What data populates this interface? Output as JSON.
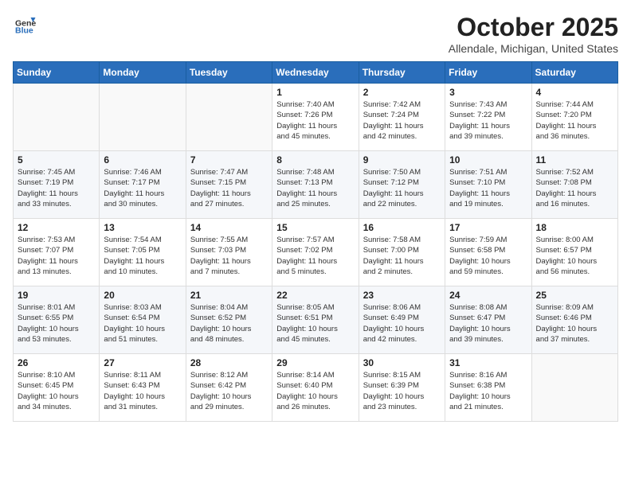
{
  "header": {
    "logo": {
      "line1": "General",
      "line2": "Blue"
    },
    "title": "October 2025",
    "location": "Allendale, Michigan, United States"
  },
  "weekdays": [
    "Sunday",
    "Monday",
    "Tuesday",
    "Wednesday",
    "Thursday",
    "Friday",
    "Saturday"
  ],
  "weeks": [
    [
      {
        "day": "",
        "detail": ""
      },
      {
        "day": "",
        "detail": ""
      },
      {
        "day": "",
        "detail": ""
      },
      {
        "day": "1",
        "detail": "Sunrise: 7:40 AM\nSunset: 7:26 PM\nDaylight: 11 hours\nand 45 minutes."
      },
      {
        "day": "2",
        "detail": "Sunrise: 7:42 AM\nSunset: 7:24 PM\nDaylight: 11 hours\nand 42 minutes."
      },
      {
        "day": "3",
        "detail": "Sunrise: 7:43 AM\nSunset: 7:22 PM\nDaylight: 11 hours\nand 39 minutes."
      },
      {
        "day": "4",
        "detail": "Sunrise: 7:44 AM\nSunset: 7:20 PM\nDaylight: 11 hours\nand 36 minutes."
      }
    ],
    [
      {
        "day": "5",
        "detail": "Sunrise: 7:45 AM\nSunset: 7:19 PM\nDaylight: 11 hours\nand 33 minutes."
      },
      {
        "day": "6",
        "detail": "Sunrise: 7:46 AM\nSunset: 7:17 PM\nDaylight: 11 hours\nand 30 minutes."
      },
      {
        "day": "7",
        "detail": "Sunrise: 7:47 AM\nSunset: 7:15 PM\nDaylight: 11 hours\nand 27 minutes."
      },
      {
        "day": "8",
        "detail": "Sunrise: 7:48 AM\nSunset: 7:13 PM\nDaylight: 11 hours\nand 25 minutes."
      },
      {
        "day": "9",
        "detail": "Sunrise: 7:50 AM\nSunset: 7:12 PM\nDaylight: 11 hours\nand 22 minutes."
      },
      {
        "day": "10",
        "detail": "Sunrise: 7:51 AM\nSunset: 7:10 PM\nDaylight: 11 hours\nand 19 minutes."
      },
      {
        "day": "11",
        "detail": "Sunrise: 7:52 AM\nSunset: 7:08 PM\nDaylight: 11 hours\nand 16 minutes."
      }
    ],
    [
      {
        "day": "12",
        "detail": "Sunrise: 7:53 AM\nSunset: 7:07 PM\nDaylight: 11 hours\nand 13 minutes."
      },
      {
        "day": "13",
        "detail": "Sunrise: 7:54 AM\nSunset: 7:05 PM\nDaylight: 11 hours\nand 10 minutes."
      },
      {
        "day": "14",
        "detail": "Sunrise: 7:55 AM\nSunset: 7:03 PM\nDaylight: 11 hours\nand 7 minutes."
      },
      {
        "day": "15",
        "detail": "Sunrise: 7:57 AM\nSunset: 7:02 PM\nDaylight: 11 hours\nand 5 minutes."
      },
      {
        "day": "16",
        "detail": "Sunrise: 7:58 AM\nSunset: 7:00 PM\nDaylight: 11 hours\nand 2 minutes."
      },
      {
        "day": "17",
        "detail": "Sunrise: 7:59 AM\nSunset: 6:58 PM\nDaylight: 10 hours\nand 59 minutes."
      },
      {
        "day": "18",
        "detail": "Sunrise: 8:00 AM\nSunset: 6:57 PM\nDaylight: 10 hours\nand 56 minutes."
      }
    ],
    [
      {
        "day": "19",
        "detail": "Sunrise: 8:01 AM\nSunset: 6:55 PM\nDaylight: 10 hours\nand 53 minutes."
      },
      {
        "day": "20",
        "detail": "Sunrise: 8:03 AM\nSunset: 6:54 PM\nDaylight: 10 hours\nand 51 minutes."
      },
      {
        "day": "21",
        "detail": "Sunrise: 8:04 AM\nSunset: 6:52 PM\nDaylight: 10 hours\nand 48 minutes."
      },
      {
        "day": "22",
        "detail": "Sunrise: 8:05 AM\nSunset: 6:51 PM\nDaylight: 10 hours\nand 45 minutes."
      },
      {
        "day": "23",
        "detail": "Sunrise: 8:06 AM\nSunset: 6:49 PM\nDaylight: 10 hours\nand 42 minutes."
      },
      {
        "day": "24",
        "detail": "Sunrise: 8:08 AM\nSunset: 6:47 PM\nDaylight: 10 hours\nand 39 minutes."
      },
      {
        "day": "25",
        "detail": "Sunrise: 8:09 AM\nSunset: 6:46 PM\nDaylight: 10 hours\nand 37 minutes."
      }
    ],
    [
      {
        "day": "26",
        "detail": "Sunrise: 8:10 AM\nSunset: 6:45 PM\nDaylight: 10 hours\nand 34 minutes."
      },
      {
        "day": "27",
        "detail": "Sunrise: 8:11 AM\nSunset: 6:43 PM\nDaylight: 10 hours\nand 31 minutes."
      },
      {
        "day": "28",
        "detail": "Sunrise: 8:12 AM\nSunset: 6:42 PM\nDaylight: 10 hours\nand 29 minutes."
      },
      {
        "day": "29",
        "detail": "Sunrise: 8:14 AM\nSunset: 6:40 PM\nDaylight: 10 hours\nand 26 minutes."
      },
      {
        "day": "30",
        "detail": "Sunrise: 8:15 AM\nSunset: 6:39 PM\nDaylight: 10 hours\nand 23 minutes."
      },
      {
        "day": "31",
        "detail": "Sunrise: 8:16 AM\nSunset: 6:38 PM\nDaylight: 10 hours\nand 21 minutes."
      },
      {
        "day": "",
        "detail": ""
      }
    ]
  ]
}
